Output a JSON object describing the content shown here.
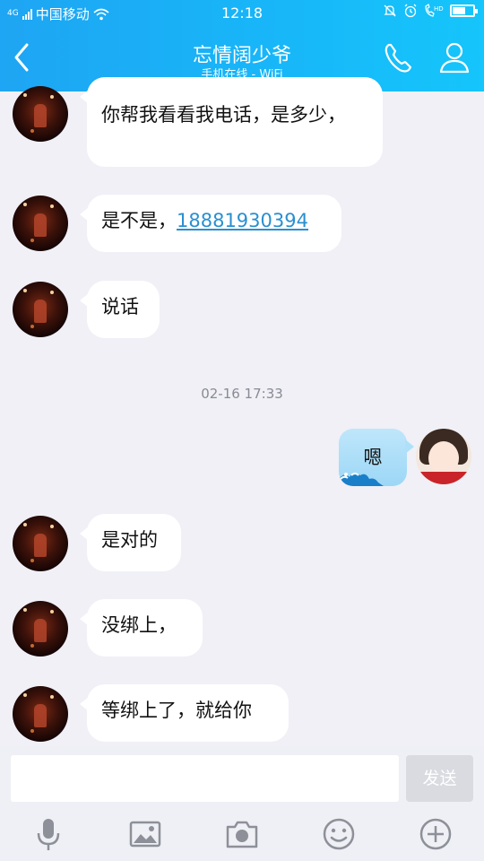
{
  "status_bar": {
    "network": "4G",
    "carrier": "中国移动",
    "time": "12:18",
    "hd": "HD"
  },
  "header": {
    "title": "忘情阔少爷",
    "subtitle": "手机在线 - WiFi"
  },
  "messages": [
    {
      "sender": "other",
      "text": "你帮我看看我电话，是多少，"
    },
    {
      "sender": "other",
      "text": "是不是，",
      "link": "18881930394"
    },
    {
      "sender": "other",
      "text": "说话"
    },
    {
      "sender": "me",
      "text": "嗯"
    },
    {
      "sender": "other",
      "text": "是对的"
    },
    {
      "sender": "other",
      "text": "没绑上，"
    },
    {
      "sender": "other",
      "text": "等绑上了，就给你"
    }
  ],
  "timestamp": "02-16 17:33",
  "input": {
    "value": "",
    "placeholder": ""
  },
  "send_label": "发送",
  "colors": {
    "header_gradient_start": "#1ea5f3",
    "header_gradient_end": "#15c5fb",
    "link": "#2a8fd0",
    "background": "#f0f0f6",
    "my_bubble": "#bfe6fb"
  },
  "toolbar": [
    "microphone-icon",
    "image-icon",
    "camera-icon",
    "emoji-icon",
    "plus-icon"
  ]
}
